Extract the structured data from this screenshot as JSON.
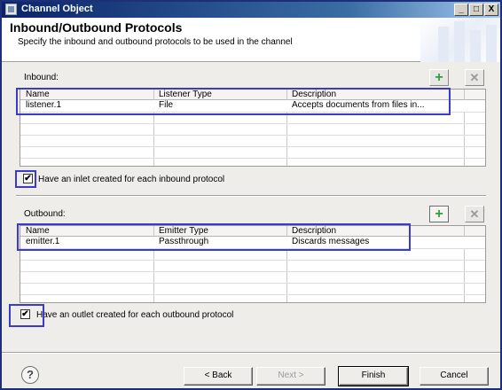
{
  "window": {
    "title": "Channel Object",
    "minimize_glyph": "_",
    "restore_glyph": "□",
    "close_glyph": "X"
  },
  "header": {
    "title": "Inbound/Outbound Protocols",
    "subtitle": "Specify the inbound and outbound protocols to be used in the channel"
  },
  "inbound": {
    "label": "Inbound:",
    "columns": [
      "Name",
      "Listener Type",
      "Description"
    ],
    "rows": [
      {
        "name": "listener.1",
        "type": "File",
        "description": "Accepts documents from files in..."
      }
    ],
    "checkbox_label": "Have an inlet created for each inbound protocol",
    "checkbox_checked": true
  },
  "outbound": {
    "label": "Outbound:",
    "columns": [
      "Name",
      "Emitter Type",
      "Description"
    ],
    "rows": [
      {
        "name": "emitter.1",
        "type": "Passthrough",
        "description": "Discards messages"
      }
    ],
    "checkbox_label": "Have an outlet created for each outbound protocol",
    "checkbox_checked": true
  },
  "icons": {
    "add": "+",
    "remove": "✕",
    "help": "?",
    "check": "✔"
  },
  "footer": {
    "back": "< Back",
    "next": "Next >",
    "finish": "Finish",
    "cancel": "Cancel"
  },
  "colors": {
    "highlight": "#3a3acc",
    "title_bar": "#0a246a",
    "add_icon": "#2fa13c"
  }
}
